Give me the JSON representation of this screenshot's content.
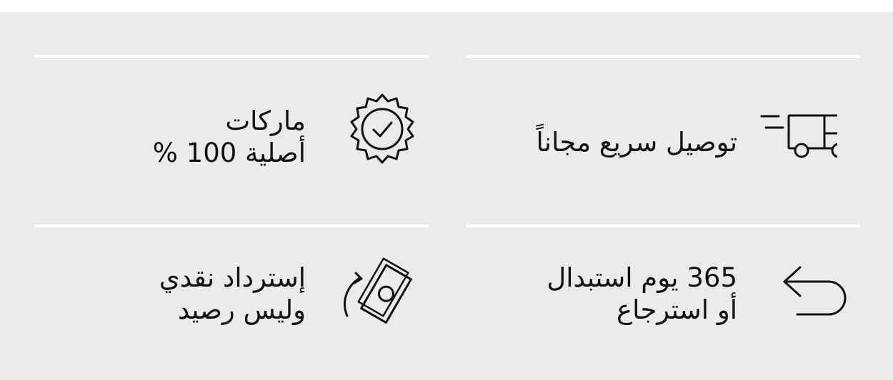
{
  "features": [
    {
      "icon": "delivery-truck-icon",
      "lines": [
        "توصيل سريع مجاناً"
      ]
    },
    {
      "icon": "verified-badge-icon",
      "lines": [
        "ماركات",
        "أصلية 100 %"
      ]
    },
    {
      "icon": "return-arrow-icon",
      "lines": [
        "365 يوم استبدال",
        "أو استرجاع"
      ]
    },
    {
      "icon": "cash-refund-icon",
      "lines": [
        "إسترداد نقدي",
        "وليس رصيد"
      ]
    }
  ],
  "colors": {
    "panel_background": "#ebebeb",
    "divider": "#ffffff",
    "text": "#111111",
    "icon_stroke": "#111111"
  }
}
